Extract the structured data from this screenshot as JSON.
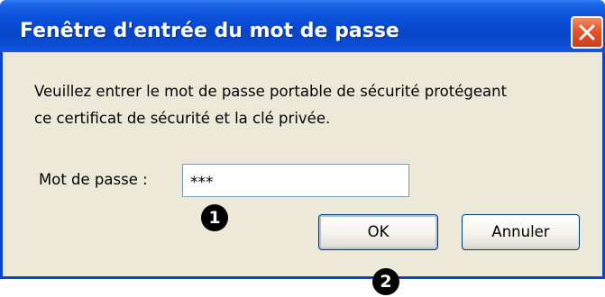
{
  "window": {
    "title": "Fenêtre d'entrée du mot de passe",
    "close_icon": "close-icon"
  },
  "message": {
    "line1": "Veuillez entrer le mot de passe portable de sécurité protégeant",
    "line2": "ce certificat de sécurité et la clé privée."
  },
  "password": {
    "label": "Mot de passe :",
    "value": "***"
  },
  "buttons": {
    "ok": "OK",
    "cancel": "Annuler"
  },
  "markers": {
    "one": "1",
    "two": "2"
  },
  "colors": {
    "titlebar": "#0845c9",
    "close_button": "#e2552c",
    "dialog_background": "#ece9d8",
    "button_border": "#003c74"
  }
}
